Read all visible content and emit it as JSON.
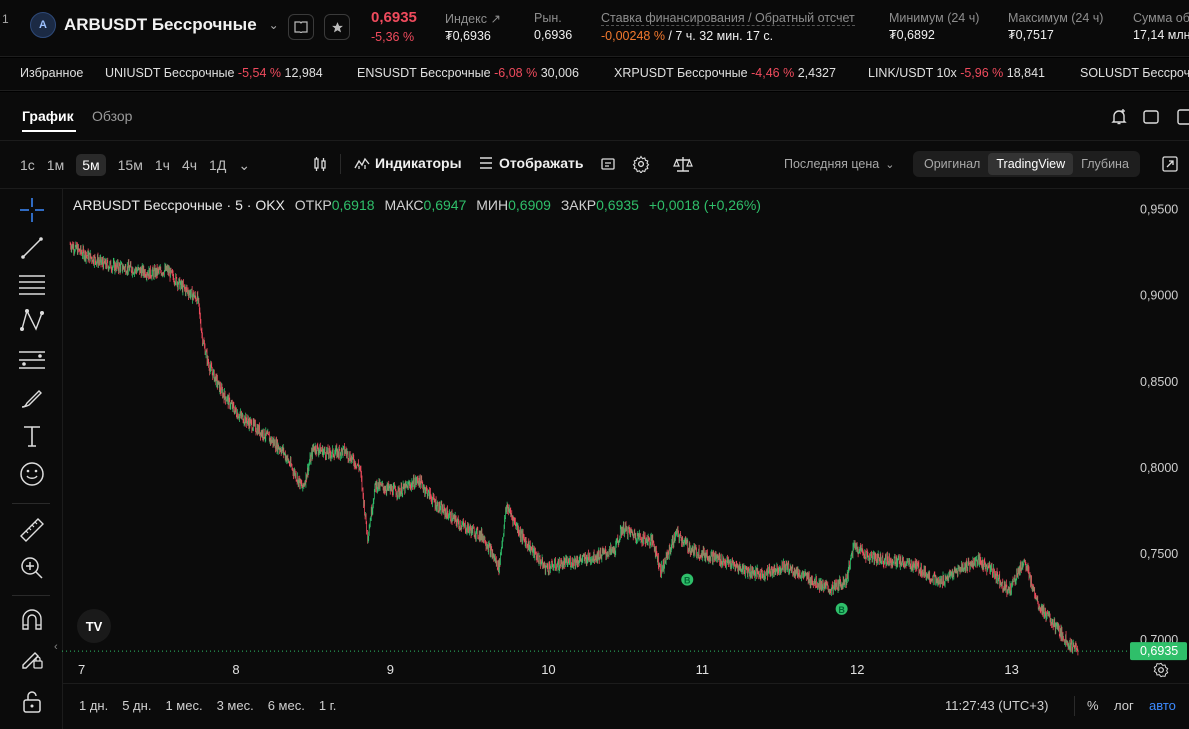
{
  "header": {
    "left_stub": "1",
    "symbol": "ARBUSDT Бессрочные",
    "last_price": "0,6935",
    "change_pct": "-5,36 %",
    "stats": [
      {
        "label": "Индекс ↗",
        "value": "₮0,6936"
      },
      {
        "label": "Рын.",
        "value": "0,6936"
      },
      {
        "label": "Ставка финансирования / Обратный отсчет",
        "value_a": "-0,00248 %",
        "value_b": "/ 7 ч. 32 мин. 17 с."
      },
      {
        "label": "Минимум (24 ч)",
        "value": "₮0,6892"
      },
      {
        "label": "Максимум (24 ч)",
        "value": "₮0,7517"
      },
      {
        "label": "Сумма об",
        "value": "17,14 млн"
      }
    ]
  },
  "ticker": {
    "favorites_label": "Избранное",
    "items": [
      {
        "name": "UNIUSDT Бессрочные",
        "change": "-5,54 %",
        "price": "12,984"
      },
      {
        "name": "ENSUSDT Бессрочные",
        "change": "-6,08 %",
        "price": "30,006"
      },
      {
        "name": "XRPUSDT Бессрочные",
        "change": "-4,46 %",
        "price": "2,4327"
      },
      {
        "name": "LINK/USDT 10x",
        "change": "-5,96 %",
        "price": "18,841"
      },
      {
        "name": "SOLUSDT Бессрочн",
        "change": "",
        "price": ""
      }
    ]
  },
  "tabs": {
    "chart": "График",
    "overview": "Обзор"
  },
  "toolbar": {
    "intervals": [
      "1с",
      "1м",
      "5м",
      "15м",
      "1ч",
      "4ч",
      "1Д"
    ],
    "active_interval": "5м",
    "indicators": "Индикаторы",
    "display": "Отображать",
    "price_type": "Последняя цена",
    "views": [
      "Оригинал",
      "TradingView",
      "Глубина"
    ],
    "active_view": "TradingView"
  },
  "legend": {
    "title": "ARBUSDT Бессрочные · 5 · OKX",
    "open_label": "ОТКР",
    "open": "0,6918",
    "high_label": "МАКС",
    "high": "0,6947",
    "low_label": "МИН",
    "low": "0,6909",
    "close_label": "ЗАКР",
    "close": "0,6935",
    "change": "+0,0018 (+0,26%)"
  },
  "colors": {
    "up": "#2fbf6a",
    "down": "#ef4b5d",
    "accent": "#3d8bff"
  },
  "chart_data": {
    "type": "candlestick",
    "x_ticks": [
      "7",
      "8",
      "9",
      "10",
      "11",
      "12",
      "13"
    ],
    "y_ticks": [
      "0,9500",
      "0,9000",
      "0,8500",
      "0,8000",
      "0,7500",
      "0,7000"
    ],
    "ylim": [
      0.686,
      0.962
    ],
    "current_price_label": "0,6935",
    "current_price": 0.6935,
    "series": [
      {
        "x": 6.92,
        "y": 0.93
      },
      {
        "x": 7.0,
        "y": 0.925
      },
      {
        "x": 7.15,
        "y": 0.918
      },
      {
        "x": 7.3,
        "y": 0.916
      },
      {
        "x": 7.45,
        "y": 0.913
      },
      {
        "x": 7.55,
        "y": 0.915
      },
      {
        "x": 7.65,
        "y": 0.905
      },
      {
        "x": 7.75,
        "y": 0.898
      },
      {
        "x": 7.78,
        "y": 0.875
      },
      {
        "x": 7.82,
        "y": 0.86
      },
      {
        "x": 7.9,
        "y": 0.845
      },
      {
        "x": 8.0,
        "y": 0.832
      },
      {
        "x": 8.1,
        "y": 0.825
      },
      {
        "x": 8.2,
        "y": 0.818
      },
      {
        "x": 8.3,
        "y": 0.81
      },
      {
        "x": 8.43,
        "y": 0.788
      },
      {
        "x": 8.5,
        "y": 0.812
      },
      {
        "x": 8.6,
        "y": 0.808
      },
      {
        "x": 8.7,
        "y": 0.81
      },
      {
        "x": 8.8,
        "y": 0.8
      },
      {
        "x": 8.85,
        "y": 0.76
      },
      {
        "x": 8.9,
        "y": 0.79
      },
      {
        "x": 9.05,
        "y": 0.786
      },
      {
        "x": 9.18,
        "y": 0.793
      },
      {
        "x": 9.3,
        "y": 0.778
      },
      {
        "x": 9.45,
        "y": 0.767
      },
      {
        "x": 9.6,
        "y": 0.76
      },
      {
        "x": 9.7,
        "y": 0.742
      },
      {
        "x": 9.75,
        "y": 0.778
      },
      {
        "x": 9.85,
        "y": 0.76
      },
      {
        "x": 10.0,
        "y": 0.742
      },
      {
        "x": 10.15,
        "y": 0.745
      },
      {
        "x": 10.3,
        "y": 0.748
      },
      {
        "x": 10.45,
        "y": 0.752
      },
      {
        "x": 10.5,
        "y": 0.765
      },
      {
        "x": 10.6,
        "y": 0.76
      },
      {
        "x": 10.7,
        "y": 0.757
      },
      {
        "x": 10.75,
        "y": 0.74
      },
      {
        "x": 10.85,
        "y": 0.762
      },
      {
        "x": 10.95,
        "y": 0.752
      },
      {
        "x": 11.1,
        "y": 0.748
      },
      {
        "x": 11.25,
        "y": 0.742
      },
      {
        "x": 11.4,
        "y": 0.738
      },
      {
        "x": 11.55,
        "y": 0.743
      },
      {
        "x": 11.7,
        "y": 0.736
      },
      {
        "x": 11.85,
        "y": 0.729
      },
      {
        "x": 11.95,
        "y": 0.735
      },
      {
        "x": 12.0,
        "y": 0.755
      },
      {
        "x": 12.1,
        "y": 0.748
      },
      {
        "x": 12.25,
        "y": 0.746
      },
      {
        "x": 12.4,
        "y": 0.743
      },
      {
        "x": 12.55,
        "y": 0.733
      },
      {
        "x": 12.7,
        "y": 0.742
      },
      {
        "x": 12.8,
        "y": 0.746
      },
      {
        "x": 12.9,
        "y": 0.74
      },
      {
        "x": 13.0,
        "y": 0.728
      },
      {
        "x": 13.1,
        "y": 0.746
      },
      {
        "x": 13.2,
        "y": 0.72
      },
      {
        "x": 13.3,
        "y": 0.708
      },
      {
        "x": 13.4,
        "y": 0.697
      },
      {
        "x": 13.45,
        "y": 0.6935
      }
    ],
    "markers": [
      {
        "label": "B",
        "x": 10.92,
        "y": 0.742
      },
      {
        "label": "B",
        "x": 11.92,
        "y": 0.725
      }
    ]
  },
  "bottom": {
    "ranges": [
      "1 дн.",
      "5 дн.",
      "1 мес.",
      "3 мес.",
      "6 мес.",
      "1 г."
    ],
    "time": "11:27:43 (UTC+3)",
    "percent": "%",
    "log": "лог",
    "auto": "авто"
  }
}
